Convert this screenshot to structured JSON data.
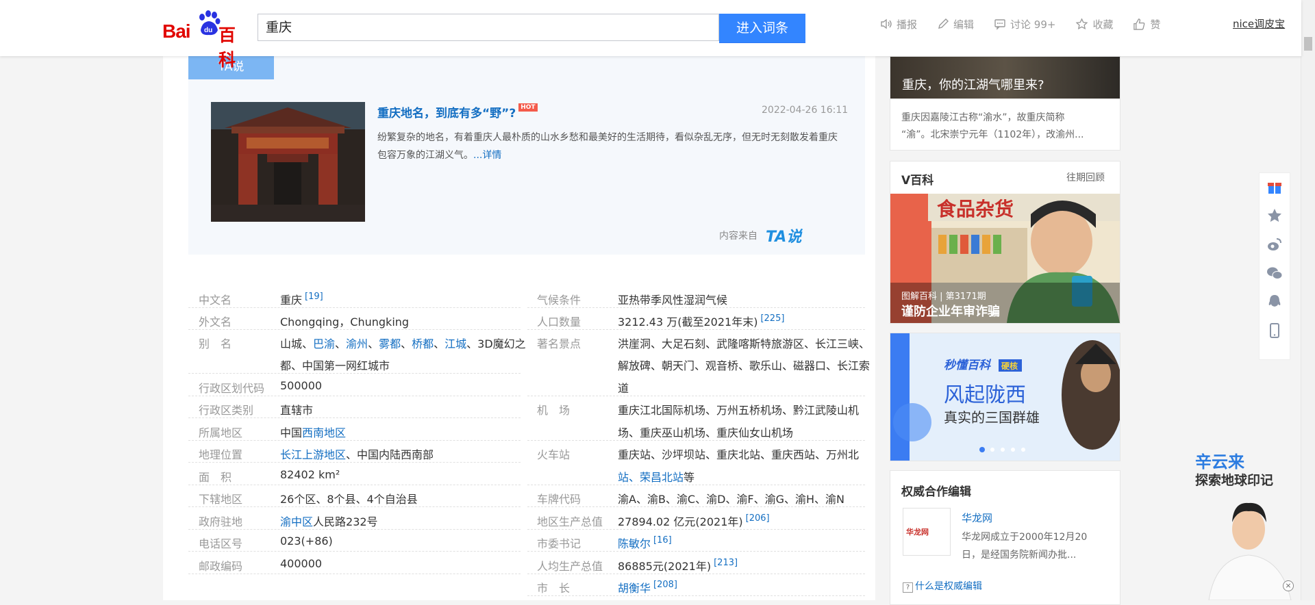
{
  "header": {
    "logo_text": "Baidu百科",
    "logo_bai": "Bai",
    "logo_du": "du",
    "logo_baike": "百科",
    "search_value": "重庆",
    "search_button": "进入词条",
    "tools": [
      {
        "icon": "speaker-icon",
        "label": "播报"
      },
      {
        "icon": "edit-icon",
        "label": "编辑"
      },
      {
        "icon": "comment-icon",
        "label": "讨论 99+"
      },
      {
        "icon": "star-icon",
        "label": "收藏"
      },
      {
        "icon": "thumbs-up-icon",
        "label": "赞"
      }
    ],
    "user_name": "nice调皮宝"
  },
  "ta": {
    "tab_label": "TA说",
    "title": "重庆地名，到底有多“野”?",
    "badge": "HOT",
    "date": "2022-04-26 16:11",
    "desc": "纷繁复杂的地名，有着重庆人最朴质的山水乡愁和最美好的生活期待，看似杂乱无序，但无时无刻散发着重庆包容万象的江湖义气。",
    "more_link": "...详情",
    "source_label": "内容来自",
    "source_logo": "TA说"
  },
  "info_left": [
    {
      "key": "中文名",
      "value": "重庆",
      "ref": "[19]"
    },
    {
      "key": "外文名",
      "value": "Chongqing，Chungking"
    },
    {
      "key": "别　名",
      "value_parts": [
        "山城、",
        "巴渝",
        "、",
        "渝州",
        "、",
        "雾都",
        "、",
        "桥都",
        "、",
        "江城",
        "、3D魔幻之"
      ]
    },
    {
      "key": "",
      "value": "都、中国第一网红城市"
    },
    {
      "key": "行政区划代码",
      "value": "500000"
    },
    {
      "key": "行政区类别",
      "link": "直辖市"
    },
    {
      "key": "所属地区",
      "value": "中国",
      "link": "西南地区"
    },
    {
      "key": "地理位置",
      "link": "长江上游地区",
      "value": "、中国内陆西南部"
    },
    {
      "key": "面　积",
      "value": "82402 km²"
    },
    {
      "key": "下辖地区",
      "value": "26个区、8个县、4个自治县"
    },
    {
      "key": "政府驻地",
      "link": "渝中区",
      "value": "人民路232号"
    },
    {
      "key": "电话区号",
      "value": "023(+86)"
    },
    {
      "key": "邮政编码",
      "value": "400000"
    }
  ],
  "info_right": [
    {
      "key": "气候条件",
      "link": "亚热带季风性湿润气候"
    },
    {
      "key": "人口数量",
      "value": "3212.43 万(截至2021年末)",
      "ref": "[225]"
    },
    {
      "key": "著名景点",
      "link": "洪崖洞、大足石刻、武隆喀斯特旅游区、长江三峡、"
    },
    {
      "key": "",
      "link": "解放碑、朝天门、观音桥、歌乐山、磁器口、长江索"
    },
    {
      "key": "",
      "link": "道"
    },
    {
      "key": "机　场",
      "link": "重庆江北国际机场、万州五桥机场、黔江武陵山机"
    },
    {
      "key": "",
      "link": "场、重庆巫山机场、重庆仙女山机场"
    },
    {
      "key": "火车站",
      "link": "重庆站、沙坪坝站、重庆北站、重庆西站、万州北"
    },
    {
      "key": "",
      "link": "站、荣昌北站",
      "value": "等"
    },
    {
      "key": "车牌代码",
      "value": "渝A、渝B、渝C、渝D、渝F、渝G、渝H、渝N"
    },
    {
      "key": "地区生产总值",
      "value": "27894.02 亿元(2021年)",
      "ref": "[206]"
    },
    {
      "key": "市委书记",
      "link": "陈敏尔",
      "ref": "[16]"
    },
    {
      "key": "人均生产总值",
      "value": "86885元(2021年)",
      "ref": "[213]"
    },
    {
      "key": "市　长",
      "link": "胡衡华",
      "ref": "[208]"
    }
  ],
  "sidebar": {
    "card1_caption": "重庆，你的江湖气哪里来?",
    "card1_desc1": "重庆因嘉陵江古称“渝水”，故重庆简称",
    "card1_desc2": "“渝”。北宋崇宁元年（1102年），改渝州...",
    "vbaike_title": "V百科",
    "vbaike_link": "往期回顾",
    "vbaike_sign": "食品杂货",
    "vbaike_sub": "图解百科 | 第3171期",
    "vbaike_caption": "谨防企业年审诈骗",
    "banner_brand": "秒懂百科",
    "banner_tag": "硬核",
    "banner_title": "风起陇西",
    "banner_sub": "真实的三国群雄",
    "auth_title": "权威合作编辑",
    "auth_name": "华龙网",
    "auth_desc1": "华龙网成立于2000年12月20",
    "auth_desc2": "日，是经国务院新闻办批...",
    "auth_logo": "华龙网",
    "auth_help": "什么是权威编辑"
  },
  "promo": {
    "line1": "辛云来",
    "line2": "探索地球印记"
  }
}
